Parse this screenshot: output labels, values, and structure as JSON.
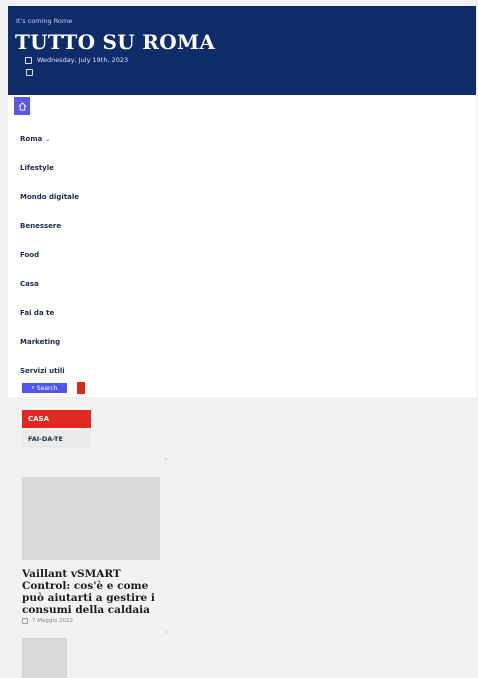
{
  "header": {
    "tagline": "It's coming Rome",
    "title": "TUTTO SU ROMA",
    "date": "Wednesday, July 19th, 2023"
  },
  "nav": {
    "items": [
      {
        "label": "Roma",
        "has_dropdown": true
      },
      {
        "label": "Lifestyle"
      },
      {
        "label": "Mondo digitale"
      },
      {
        "label": "Benessere"
      },
      {
        "label": "Food"
      },
      {
        "label": "Casa"
      },
      {
        "label": "Fai da te"
      },
      {
        "label": "Marketing"
      },
      {
        "label": "Servizi utili"
      }
    ],
    "search_label": "Search",
    "home_icon": "home-icon"
  },
  "content": {
    "tags": [
      "CASA",
      "FAI-DA-TE"
    ],
    "article": {
      "title": "Vaillant vSMART Control: cos'è e come può aiutarti a gestire i consumi della caldaia",
      "date": "7 Maggio 2022"
    }
  },
  "colors": {
    "header_bg": "#0f2c6a",
    "accent": "#5b58e6",
    "red": "#e12920"
  }
}
